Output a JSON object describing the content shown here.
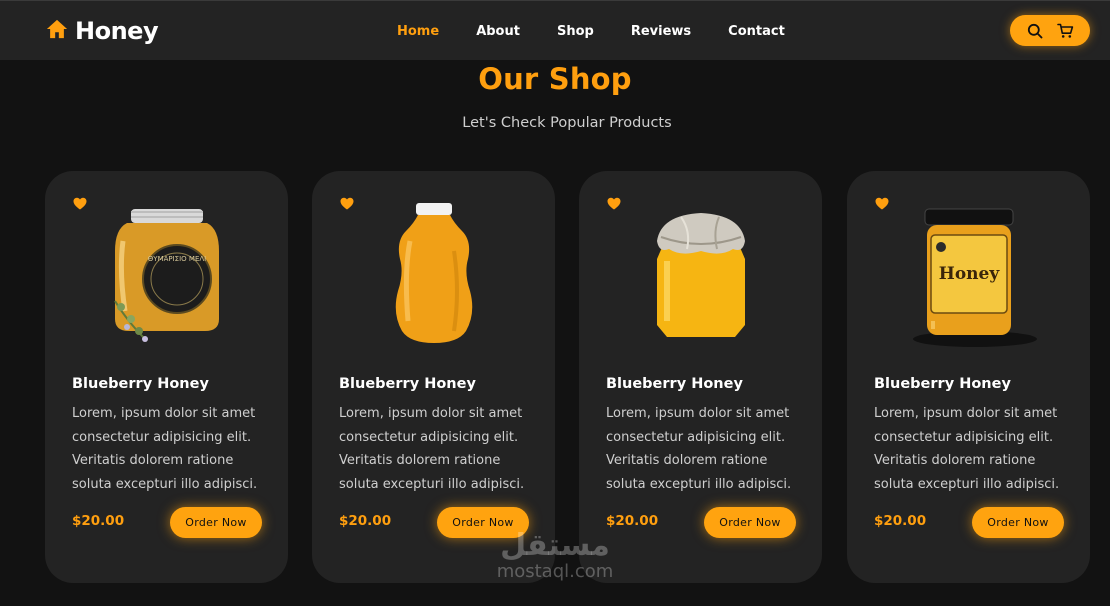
{
  "brand": {
    "name": "Honey",
    "icon": "home-icon",
    "accent": "#ff9f0f"
  },
  "nav": {
    "items": [
      {
        "label": "Home",
        "active": true
      },
      {
        "label": "About",
        "active": false
      },
      {
        "label": "Shop",
        "active": false
      },
      {
        "label": "Reviews",
        "active": false
      },
      {
        "label": "Contact",
        "active": false
      }
    ]
  },
  "header_actions": {
    "search_icon": "search-icon",
    "cart_icon": "cart-icon"
  },
  "section": {
    "title": "Our Shop",
    "subtitle": "Let's Check Popular Products"
  },
  "products": [
    {
      "name": "Blueberry Honey",
      "description": "Lorem, ipsum dolor sit amet consectetur adipisicing elit. Veritatis dolorem ratione soluta excepturi illo adipisci.",
      "price": "$20.00",
      "button": "Order Now",
      "image": "round-jar-with-label",
      "label_text": "ΘΥΜΑΡΙΣΙΟ ΜΕΛΙ"
    },
    {
      "name": "Blueberry Honey",
      "description": "Lorem, ipsum dolor sit amet consectetur adipisicing elit. Veritatis dolorem ratione soluta excepturi illo adipisci.",
      "price": "$20.00",
      "button": "Order Now",
      "image": "tall-plastic-honey-bottle"
    },
    {
      "name": "Blueberry Honey",
      "description": "Lorem, ipsum dolor sit amet consectetur adipisicing elit. Veritatis dolorem ratione soluta excepturi illo adipisci.",
      "price": "$20.00",
      "button": "Order Now",
      "image": "hexagonal-jar-with-cloth-lid"
    },
    {
      "name": "Blueberry Honey",
      "description": "Lorem, ipsum dolor sit amet consectetur adipisicing elit. Veritatis dolorem ratione soluta excepturi illo adipisci.",
      "price": "$20.00",
      "button": "Order Now",
      "image": "jar-with-honey-label",
      "label_text": "Honey"
    }
  ],
  "watermark": {
    "arabic": "مستقل",
    "latin": "mostaql.com"
  }
}
